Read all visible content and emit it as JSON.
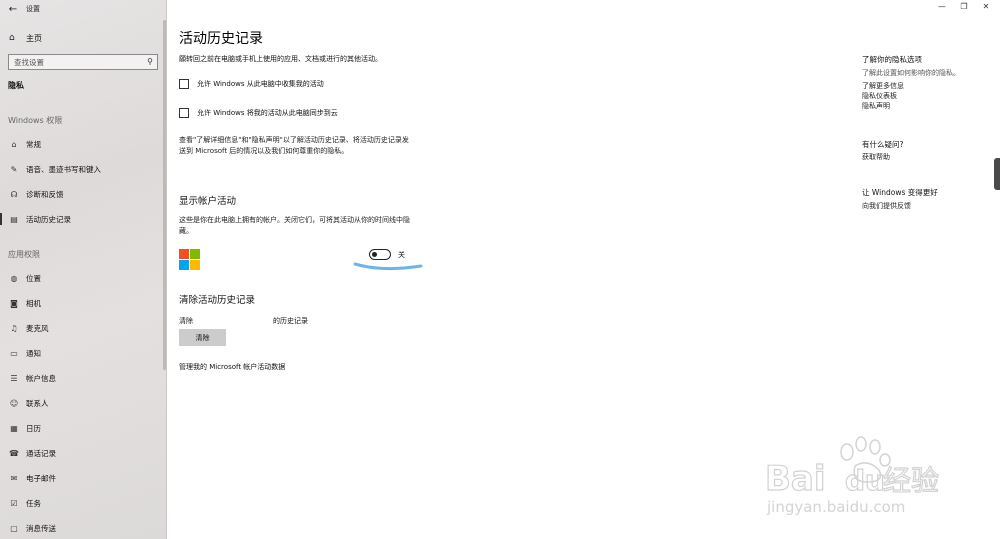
{
  "window": {
    "title": "设置",
    "controls": [
      "—",
      "❐",
      "✕"
    ]
  },
  "sidebar": {
    "back_icon": "←",
    "home_label": "主页",
    "home_icon": "⌂",
    "search_placeholder": "查找设置",
    "search_icon": "⚲",
    "current_section": "隐私",
    "groups": [
      {
        "title": "Windows 权限",
        "items": [
          {
            "label": "常规",
            "icon": "lock-icon",
            "glyph": "⌂"
          },
          {
            "label": "语音、墨迹书写和键入",
            "icon": "speech-ink-icon",
            "glyph": "✎"
          },
          {
            "label": "诊断和反馈",
            "icon": "feedback-icon",
            "glyph": "☊"
          },
          {
            "label": "活动历史记录",
            "icon": "activity-icon",
            "glyph": "▤",
            "active": true
          }
        ]
      },
      {
        "title": "应用权限",
        "items": [
          {
            "label": "位置",
            "icon": "location-icon",
            "glyph": "◍"
          },
          {
            "label": "相机",
            "icon": "camera-icon",
            "glyph": "◙"
          },
          {
            "label": "麦克风",
            "icon": "microphone-icon",
            "glyph": "♫"
          },
          {
            "label": "通知",
            "icon": "notification-icon",
            "glyph": "▭"
          },
          {
            "label": "帐户信息",
            "icon": "account-info-icon",
            "glyph": "☰"
          },
          {
            "label": "联系人",
            "icon": "contacts-icon",
            "glyph": "☺"
          },
          {
            "label": "日历",
            "icon": "calendar-icon",
            "glyph": "▦"
          },
          {
            "label": "通话记录",
            "icon": "call-history-icon",
            "glyph": "☎"
          },
          {
            "label": "电子邮件",
            "icon": "email-icon",
            "glyph": "✉"
          },
          {
            "label": "任务",
            "icon": "tasks-icon",
            "glyph": "☑"
          },
          {
            "label": "消息传送",
            "icon": "messaging-icon",
            "glyph": "▢"
          }
        ]
      }
    ]
  },
  "main": {
    "title": "活动历史记录",
    "description": "願转回之前在电脑或手机上使用的应用、文档或进行的其他活动。",
    "checkbox_collect": "允许 Windows 从此电脑中收集我的活动",
    "checkbox_sync": "允许 Windows 将我的活动从此电脑同步到云",
    "info_paragraph": "查看\"了解详细信息\"和\"隐私声明\"以了解活动历史记录、将活动历史记录发送到 Microsoft 后的情况以及我们如何尊重你的隐私。",
    "accounts_heading": "显示帐户活动",
    "accounts_paragraph": "这些是你在此电脑上拥有的帐户。关闭它们，可将其活动从你的时间线中隐藏。",
    "toggle_state": "关",
    "clear_heading": "清除活动历史记录",
    "clear_prefix": "清除",
    "clear_suffix": "的历史记录",
    "clear_button": "清除",
    "manage_link": "管理我的 Microsoft 帐户活动数据"
  },
  "right": {
    "privacy_heading": "了解你的隐私选项",
    "privacy_desc": "了解此设置如何影响你的隐私。",
    "links": [
      "了解更多信息",
      "隐私仪表板",
      "隐私声明"
    ],
    "question_heading": "有什么疑问?",
    "help_link": "获取帮助",
    "improve_heading": "让 Windows 变得更好",
    "feedback_link": "向我们提供反馈"
  },
  "colors": {
    "ms_red": "#f25022",
    "ms_green": "#7fba00",
    "ms_blue": "#00a4ef",
    "ms_yellow": "#ffb900",
    "annotation_blue": "#6fb4e8"
  },
  "watermark": {
    "brand": "Bai",
    "brand2": "du",
    "cn": "经验",
    "url": "jingyan.baidu.com"
  }
}
